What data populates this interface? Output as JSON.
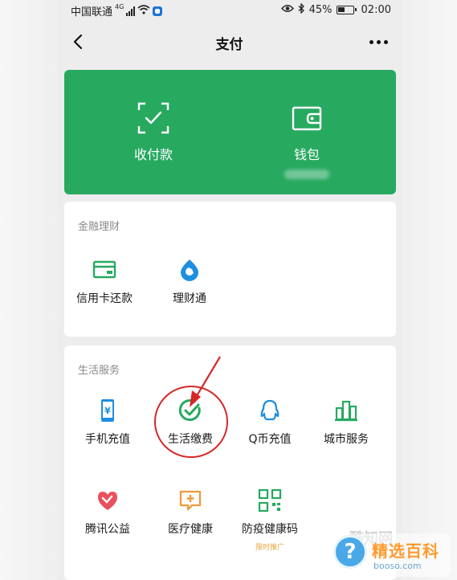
{
  "status_bar": {
    "carrier": "中国联通",
    "network": "4G",
    "battery_pct": "45%",
    "time": "02:00"
  },
  "nav": {
    "title": "支付",
    "back_icon": "chevron-left-icon",
    "more_icon": "ellipsis-icon"
  },
  "pay_card": {
    "color": "#27a960",
    "items": [
      {
        "label": "收付款",
        "icon": "scan-check-icon"
      },
      {
        "label": "钱包",
        "icon": "wallet-icon"
      }
    ]
  },
  "finance": {
    "title": "金融理财",
    "items": [
      {
        "label": "信用卡还款",
        "icon": "credit-card-icon"
      },
      {
        "label": "理财通",
        "icon": "wealth-drop-icon"
      }
    ]
  },
  "life": {
    "title": "生活服务",
    "items": [
      {
        "label": "手机充值",
        "icon": "phone-yuan-icon"
      },
      {
        "label": "生活缴费",
        "icon": "check-circle-icon"
      },
      {
        "label": "Q币充值",
        "icon": "qq-penguin-icon"
      },
      {
        "label": "城市服务",
        "icon": "city-buildings-icon"
      },
      {
        "label": "腾讯公益",
        "icon": "charity-heart-icon"
      },
      {
        "label": "医疗健康",
        "icon": "medical-plus-icon"
      },
      {
        "label": "防疫健康码",
        "icon": "qr-code-icon",
        "tag": "限时推广"
      }
    ]
  },
  "watermark": {
    "name": "精选百科",
    "url": "booso.com",
    "faded": "酷知网",
    "symbol": "?"
  }
}
